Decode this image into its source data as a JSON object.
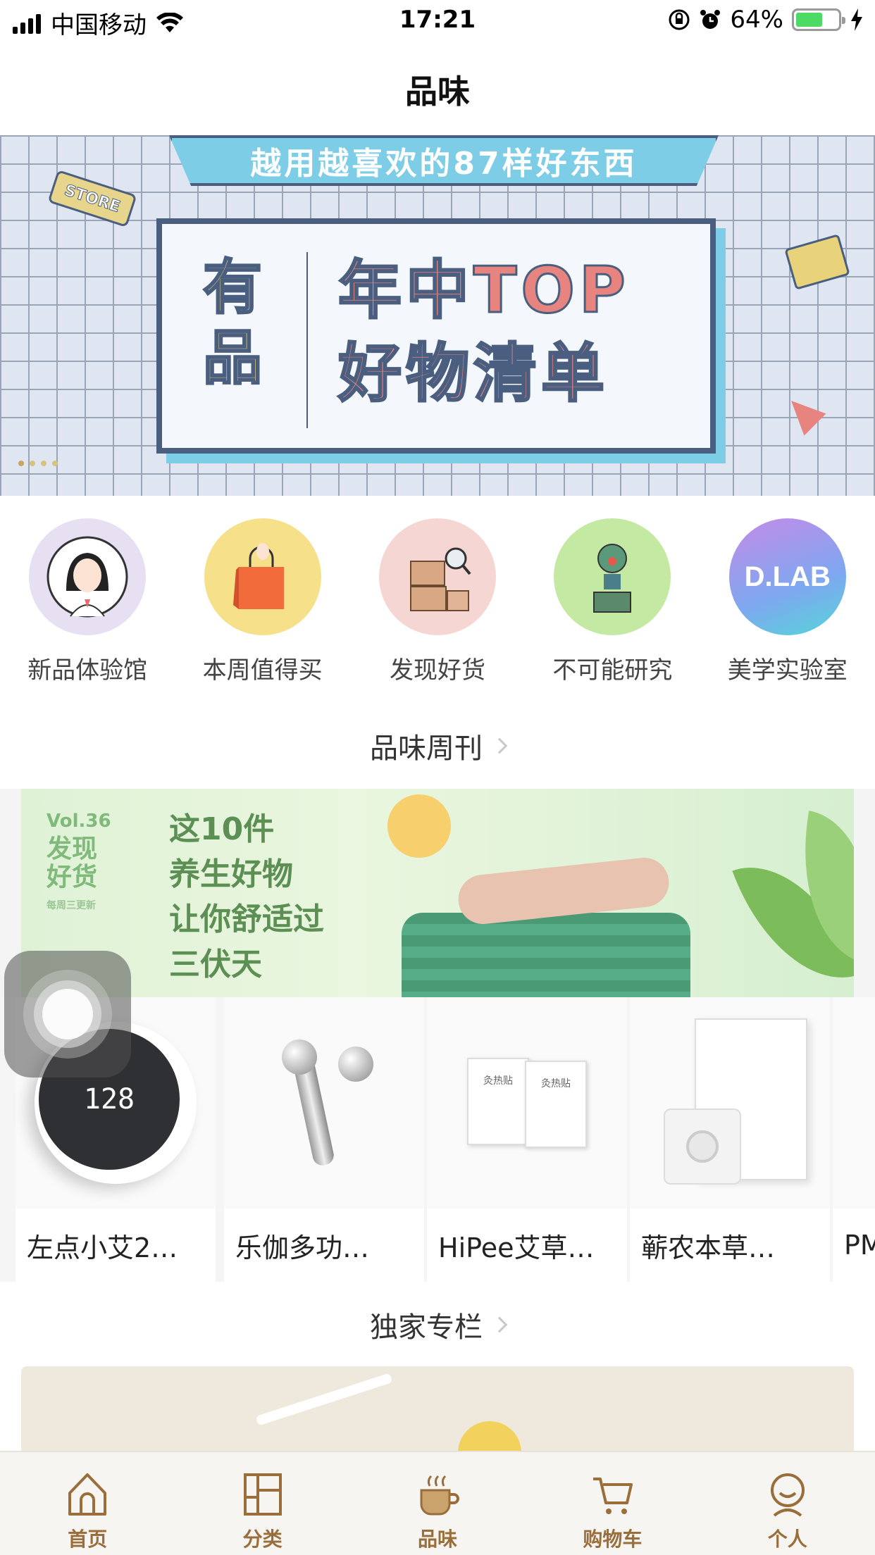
{
  "status_bar": {
    "carrier": "中国移动",
    "time": "17:21",
    "battery_percent": "64%",
    "battery_level": 0.64,
    "icons": [
      "signal-icon",
      "wifi-icon",
      "rotation-lock-icon",
      "alarm-icon",
      "battery-icon",
      "charging-icon"
    ]
  },
  "nav": {
    "title": "品味"
  },
  "hero": {
    "ribbon_text": "越用越喜欢的87样好东西",
    "left_text_1": "有",
    "left_text_2": "品",
    "right_text_1": "年中TOP",
    "right_text_2": "好物清单",
    "sign_text": "STORE",
    "slide_count": 4,
    "active_slide": 1
  },
  "categories": [
    {
      "label": "新品体验馆",
      "icon": "girl-avatar-icon",
      "color": "#e6e0f2"
    },
    {
      "label": "本周值得买",
      "icon": "shopping-bag-icon",
      "color": "#f7e08a"
    },
    {
      "label": "发现好货",
      "icon": "boxes-search-icon",
      "color": "#f6d6d2"
    },
    {
      "label": "不可能研究",
      "icon": "robot-figure-icon",
      "color": "#c4e9a2"
    },
    {
      "label": "美学实验室",
      "icon": "dlab-logo-icon",
      "color": "#b58fea",
      "logo_text": "D.LAB"
    }
  ],
  "weekly": {
    "section_title": "品味周刊",
    "vol": "Vol.36",
    "vol_title_1": "发现",
    "vol_title_2": "好货",
    "vol_sub": "每周三更新",
    "headline_1": "这10件",
    "headline_2": "养生好物",
    "headline_3": "让你舒适过",
    "headline_4": "三伏天"
  },
  "products": [
    {
      "name": "左点小艾2…",
      "thermo_reading": "128"
    },
    {
      "name": "乐伽多功…"
    },
    {
      "name": "HiPee艾草…",
      "pack_text": "灸热贴"
    },
    {
      "name": "蕲农本草…"
    },
    {
      "name": "PM"
    }
  ],
  "exclusive": {
    "section_title": "独家专栏"
  },
  "tabbar": {
    "items": [
      {
        "label": "首页",
        "icon": "home-icon"
      },
      {
        "label": "分类",
        "icon": "category-icon"
      },
      {
        "label": "品味",
        "icon": "coffee-cup-icon",
        "active": true
      },
      {
        "label": "购物车",
        "icon": "cart-icon"
      },
      {
        "label": "个人",
        "icon": "profile-icon"
      }
    ],
    "accent_color": "#9a6e3a"
  }
}
